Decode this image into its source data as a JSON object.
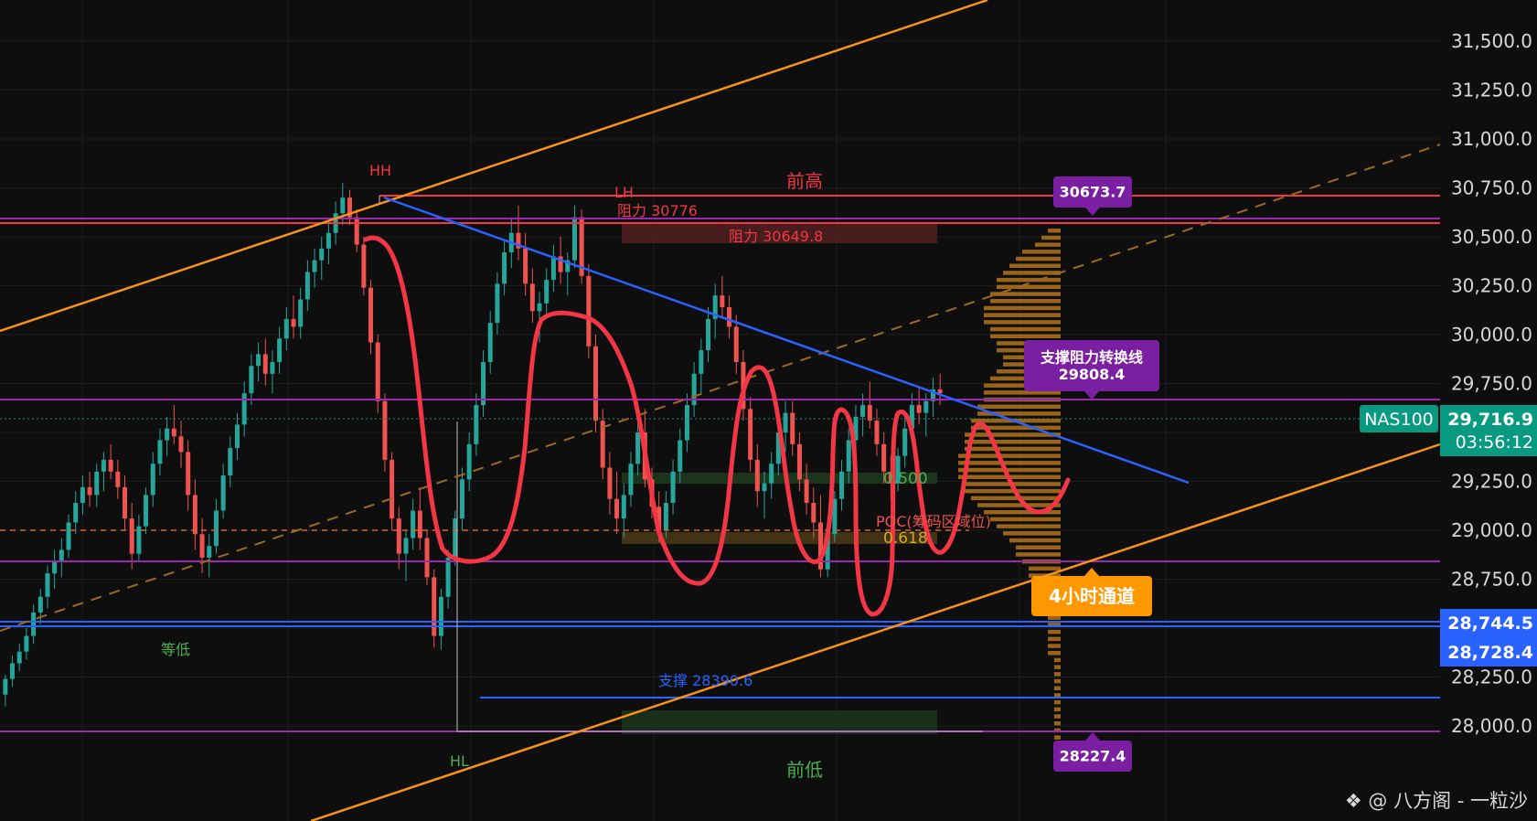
{
  "chart_data": {
    "type": "candlestick",
    "symbol": "NAS100",
    "current_price": "29,716.9",
    "countdown": "03:56:12",
    "y_ticks": [
      "31,500.0",
      "31,250.0",
      "31,000.0",
      "30,750.0",
      "30,500.0",
      "30,250.0",
      "30,000.0",
      "29,750.0",
      "29,500.0",
      "29,250.0",
      "29,000.0",
      "28,750.0",
      "28,500.0",
      "28,250.0",
      "28,000.0"
    ],
    "y_tick_values": [
      31500,
      31250,
      31000,
      30750,
      30500,
      30250,
      30000,
      29750,
      29500,
      29250,
      29000,
      28750,
      28500,
      28250,
      28000
    ],
    "price_tags": {
      "upper_blue": "28,744.5",
      "lower_blue": "28,728.4",
      "top_purple": "30673.7",
      "bottom_purple": "28227.4",
      "mid_purple_title": "支撑阻力转换线",
      "mid_purple_value": "29808.4",
      "channel_label": "4小时通道"
    },
    "levels": {
      "resistance_upper": "阻力 30776",
      "resistance_lower": "阻力 30649.8",
      "support": "支撑 28390.6",
      "prior_high": "前高",
      "prior_low": "前低",
      "equal_low": "等低",
      "poc": "POC(筹码区域位)",
      "fib_500": "0.500",
      "fib_618": "0.618"
    },
    "pivots": {
      "hh": "HH",
      "lh": "LH",
      "hl": "HL"
    },
    "candles_ohlc": [
      [
        28160,
        28260,
        28100,
        28240
      ],
      [
        28240,
        28360,
        28200,
        28320
      ],
      [
        28320,
        28420,
        28280,
        28380
      ],
      [
        28380,
        28500,
        28340,
        28460
      ],
      [
        28460,
        28620,
        28420,
        28580
      ],
      [
        28580,
        28700,
        28520,
        28660
      ],
      [
        28660,
        28820,
        28600,
        28780
      ],
      [
        28780,
        28900,
        28700,
        28840
      ],
      [
        28840,
        28960,
        28760,
        28900
      ],
      [
        28900,
        29080,
        28860,
        29040
      ],
      [
        29040,
        29200,
        28980,
        29140
      ],
      [
        29140,
        29280,
        29080,
        29220
      ],
      [
        29220,
        29300,
        29120,
        29180
      ],
      [
        29180,
        29340,
        29120,
        29300
      ],
      [
        29300,
        29400,
        29200,
        29360
      ],
      [
        29360,
        29440,
        29260,
        29300
      ],
      [
        29300,
        29360,
        29160,
        29220
      ],
      [
        29220,
        29280,
        29000,
        29060
      ],
      [
        29060,
        29140,
        28800,
        28880
      ],
      [
        28880,
        29080,
        28840,
        29020
      ],
      [
        29020,
        29220,
        28980,
        29180
      ],
      [
        29180,
        29400,
        29120,
        29340
      ],
      [
        29340,
        29520,
        29280,
        29460
      ],
      [
        29460,
        29580,
        29380,
        29520
      ],
      [
        29520,
        29640,
        29440,
        29480
      ],
      [
        29480,
        29560,
        29320,
        29400
      ],
      [
        29400,
        29460,
        29100,
        29180
      ],
      [
        29180,
        29260,
        28900,
        28980
      ],
      [
        28980,
        29060,
        28780,
        28860
      ],
      [
        28860,
        28980,
        28760,
        28920
      ],
      [
        28920,
        29160,
        28880,
        29100
      ],
      [
        29100,
        29340,
        29060,
        29280
      ],
      [
        29280,
        29480,
        29220,
        29420
      ],
      [
        29420,
        29600,
        29360,
        29540
      ],
      [
        29540,
        29760,
        29480,
        29700
      ],
      [
        29700,
        29900,
        29640,
        29840
      ],
      [
        29840,
        29960,
        29760,
        29900
      ],
      [
        29900,
        29980,
        29740,
        29800
      ],
      [
        29800,
        29920,
        29700,
        29860
      ],
      [
        29860,
        30040,
        29800,
        29980
      ],
      [
        29980,
        30140,
        29920,
        30080
      ],
      [
        30080,
        30200,
        29980,
        30040
      ],
      [
        30040,
        30240,
        29980,
        30180
      ],
      [
        30180,
        30380,
        30120,
        30320
      ],
      [
        30320,
        30440,
        30240,
        30380
      ],
      [
        30380,
        30500,
        30280,
        30440
      ],
      [
        30440,
        30580,
        30360,
        30520
      ],
      [
        30520,
        30680,
        30460,
        30620
      ],
      [
        30620,
        30776,
        30560,
        30700
      ],
      [
        30700,
        30740,
        30560,
        30600
      ],
      [
        30600,
        30640,
        30420,
        30460
      ],
      [
        30460,
        30500,
        30200,
        30240
      ],
      [
        30240,
        30280,
        29900,
        29960
      ],
      [
        29960,
        30000,
        29600,
        29660
      ],
      [
        29660,
        29700,
        29300,
        29360
      ],
      [
        29360,
        29400,
        29000,
        29060
      ],
      [
        29060,
        29120,
        28800,
        28880
      ],
      [
        28880,
        29000,
        28740,
        28960
      ],
      [
        28960,
        29160,
        28900,
        29100
      ],
      [
        29100,
        29220,
        28900,
        28960
      ],
      [
        28960,
        29000,
        28720,
        28760
      ],
      [
        28760,
        28800,
        28400,
        28460
      ],
      [
        28460,
        28700,
        28390,
        28660
      ],
      [
        28660,
        28900,
        28600,
        28860
      ],
      [
        28860,
        29100,
        28820,
        29060
      ],
      [
        29060,
        29320,
        29000,
        29260
      ],
      [
        29260,
        29500,
        29200,
        29440
      ],
      [
        29440,
        29700,
        29380,
        29640
      ],
      [
        29640,
        29920,
        29580,
        29860
      ],
      [
        29860,
        30120,
        29800,
        30060
      ],
      [
        30060,
        30320,
        30000,
        30260
      ],
      [
        30260,
        30480,
        30200,
        30420
      ],
      [
        30420,
        30600,
        30340,
        30520
      ],
      [
        30520,
        30660,
        30380,
        30440
      ],
      [
        30440,
        30520,
        30200,
        30260
      ],
      [
        30260,
        30340,
        30060,
        30120
      ],
      [
        30120,
        30220,
        29960,
        30160
      ],
      [
        30160,
        30340,
        30100,
        30280
      ],
      [
        30280,
        30460,
        30220,
        30400
      ],
      [
        30400,
        30500,
        30260,
        30320
      ],
      [
        30320,
        30420,
        30200,
        30380
      ],
      [
        30380,
        30660,
        30340,
        30600
      ],
      [
        30600,
        30640,
        30260,
        30300
      ],
      [
        30300,
        30360,
        29880,
        29940
      ],
      [
        29940,
        30000,
        29500,
        29560
      ],
      [
        29560,
        29620,
        29260,
        29320
      ],
      [
        29320,
        29400,
        29080,
        29160
      ],
      [
        29160,
        29300,
        28980,
        29060
      ],
      [
        29060,
        29240,
        28960,
        29180
      ],
      [
        29180,
        29400,
        29120,
        29340
      ],
      [
        29340,
        29560,
        29280,
        29500
      ],
      [
        29500,
        29620,
        29220,
        29260
      ],
      [
        29260,
        29320,
        29060,
        29120
      ],
      [
        29120,
        29200,
        28940,
        29000
      ],
      [
        29000,
        29200,
        28960,
        29140
      ],
      [
        29140,
        29360,
        29080,
        29300
      ],
      [
        29300,
        29520,
        29240,
        29460
      ],
      [
        29460,
        29700,
        29400,
        29640
      ],
      [
        29640,
        29860,
        29580,
        29800
      ],
      [
        29800,
        29980,
        29700,
        29920
      ],
      [
        29920,
        30140,
        29860,
        30080
      ],
      [
        30080,
        30260,
        29980,
        30200
      ],
      [
        30200,
        30300,
        30080,
        30140
      ],
      [
        30140,
        30200,
        29980,
        30040
      ],
      [
        30040,
        30100,
        29800,
        29860
      ],
      [
        29860,
        29920,
        29560,
        29620
      ],
      [
        29620,
        29680,
        29300,
        29360
      ],
      [
        29360,
        29440,
        29120,
        29200
      ],
      [
        29200,
        29300,
        29060,
        29240
      ],
      [
        29240,
        29400,
        29160,
        29340
      ],
      [
        29340,
        29560,
        29280,
        29500
      ],
      [
        29500,
        29660,
        29400,
        29600
      ],
      [
        29600,
        29660,
        29380,
        29440
      ],
      [
        29440,
        29500,
        29200,
        29260
      ],
      [
        29260,
        29340,
        29080,
        29140
      ],
      [
        29140,
        29220,
        28960,
        29040
      ],
      [
        29040,
        29180,
        28760,
        28800
      ],
      [
        28800,
        29020,
        28760,
        28980
      ],
      [
        28980,
        29200,
        28940,
        29160
      ],
      [
        29160,
        29360,
        29100,
        29300
      ],
      [
        29300,
        29520,
        29240,
        29460
      ],
      [
        29460,
        29640,
        29380,
        29580
      ],
      [
        29580,
        29700,
        29480,
        29640
      ],
      [
        29640,
        29760,
        29520,
        29560
      ],
      [
        29560,
        29620,
        29380,
        29440
      ],
      [
        29440,
        29500,
        29240,
        29300
      ],
      [
        29300,
        29380,
        29160,
        29240
      ],
      [
        29240,
        29420,
        29200,
        29380
      ],
      [
        29380,
        29580,
        29320,
        29520
      ],
      [
        29520,
        29700,
        29460,
        29640
      ],
      [
        29640,
        29740,
        29540,
        29600
      ],
      [
        29600,
        29700,
        29480,
        29660
      ],
      [
        29660,
        29780,
        29580,
        29720
      ],
      [
        29720,
        29800,
        29640,
        29700
      ]
    ]
  },
  "watermark": "@ 八方阁 - 一粒沙"
}
